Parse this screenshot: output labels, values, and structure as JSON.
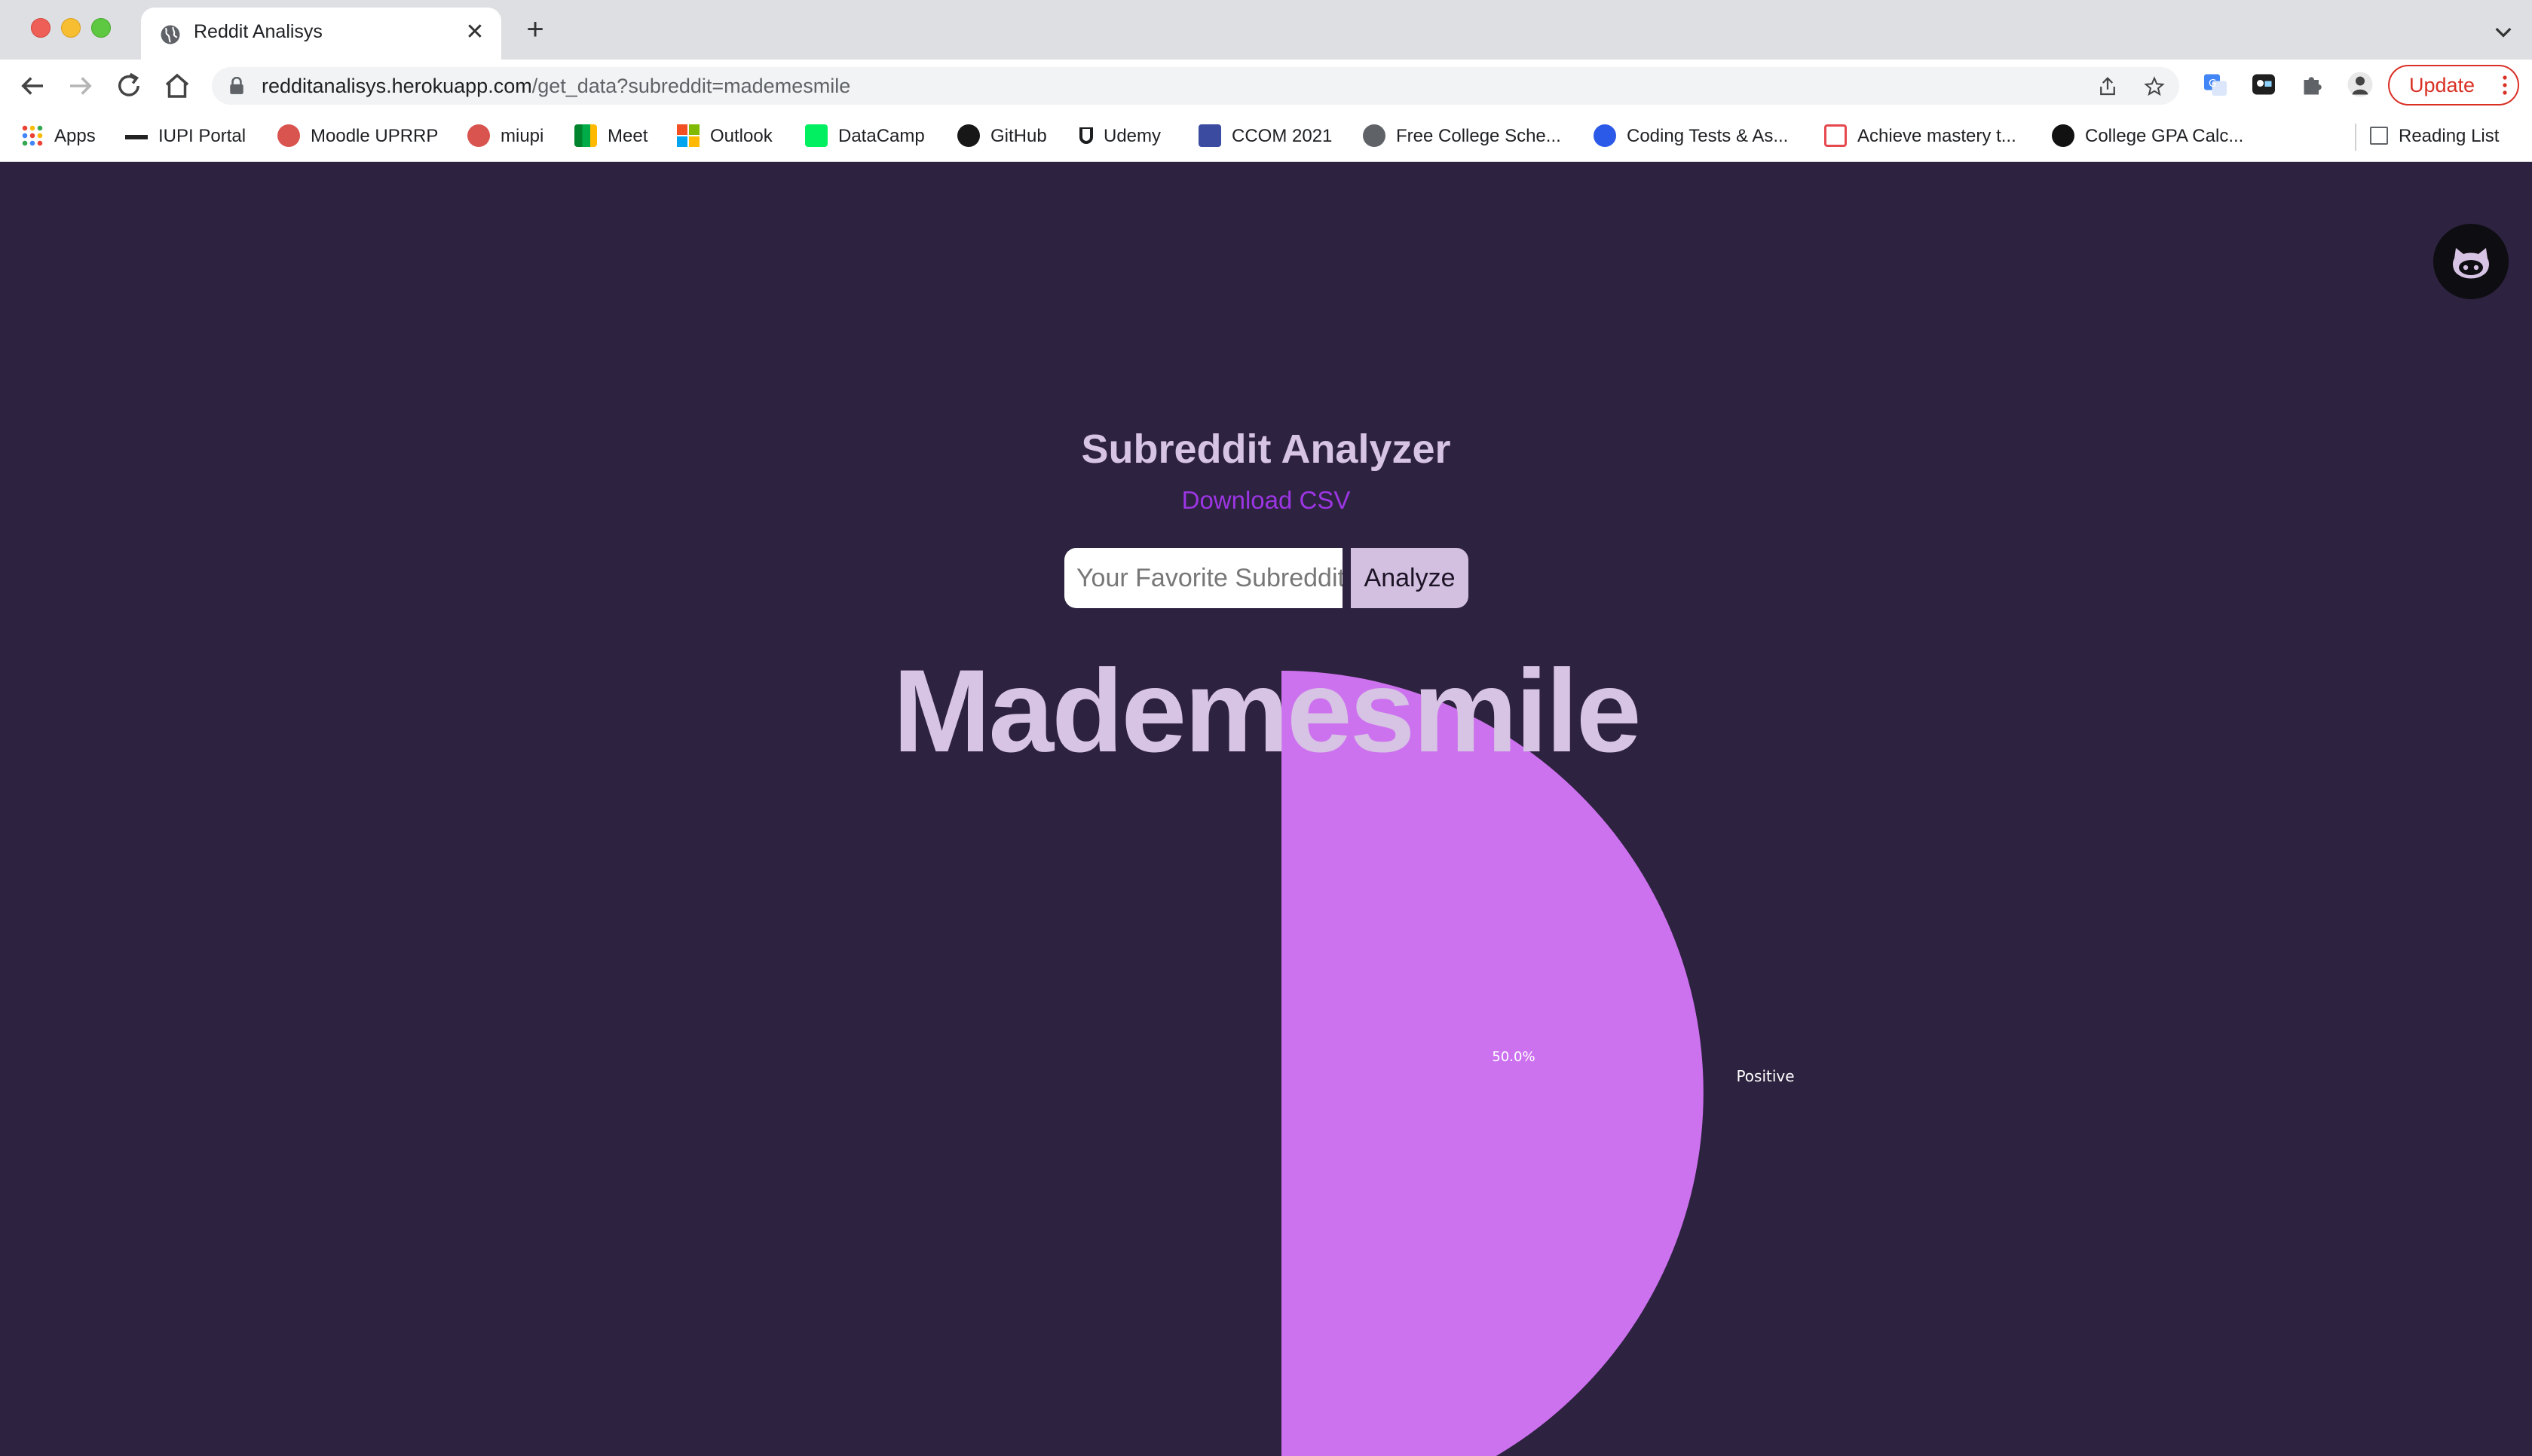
{
  "browser": {
    "tab": {
      "title": "Reddit Analisys",
      "favicon": "globe-icon"
    },
    "url": {
      "host": "redditanalisys.herokuapp.com",
      "path": "/get_data?subreddit=mademesmile"
    },
    "update_label": "Update",
    "bookmarks": [
      {
        "label": "Apps",
        "icon": "apps-grid-icon",
        "color": "#4285f4"
      },
      {
        "label": "IUPI Portal",
        "icon": "upr-icon",
        "color": "#222222"
      },
      {
        "label": "Moodle UPRRP",
        "icon": "moodle-icon",
        "color": "#d9534f"
      },
      {
        "label": "miupi",
        "icon": "miupi-icon",
        "color": "#d9534f"
      },
      {
        "label": "Meet",
        "icon": "meet-icon",
        "color": "#00ac47"
      },
      {
        "label": "Outlook",
        "icon": "outlook-icon",
        "color": "#f25022"
      },
      {
        "label": "DataCamp",
        "icon": "datacamp-icon",
        "color": "#03ef62"
      },
      {
        "label": "GitHub",
        "icon": "github-icon",
        "color": "#181717"
      },
      {
        "label": "Udemy",
        "icon": "udemy-icon",
        "color": "#1c1d1f"
      },
      {
        "label": "CCOM 2021",
        "icon": "ccom-icon",
        "color": "#3b4ba0"
      },
      {
        "label": "Free College Sche...",
        "icon": "globe-icon",
        "color": "#5f6368"
      },
      {
        "label": "Coding Tests & As...",
        "icon": "coding-tests-icon",
        "color": "#2b59e8"
      },
      {
        "label": "Achieve mastery t...",
        "icon": "mastery-icon",
        "color": "#e5484d"
      },
      {
        "label": "College GPA Calc...",
        "icon": "gpa-icon",
        "color": "#111111"
      }
    ],
    "reading_list": "Reading List"
  },
  "page": {
    "title": "Subreddit Analyzer",
    "download_label": "Download CSV",
    "search_placeholder": "Your Favorite Subreddit",
    "analyze_label": "Analyze",
    "subreddit": "Mademesmile"
  },
  "chart_data": {
    "type": "pie",
    "slices": [
      {
        "label": "Positive",
        "value": 50.0,
        "value_label": "50.0%",
        "color": "#cd72ef"
      }
    ]
  },
  "colors": {
    "page_bg": "#2d223f",
    "title": "#d7c3e3",
    "link": "#9c35e3",
    "slice": "#cd72ef"
  }
}
